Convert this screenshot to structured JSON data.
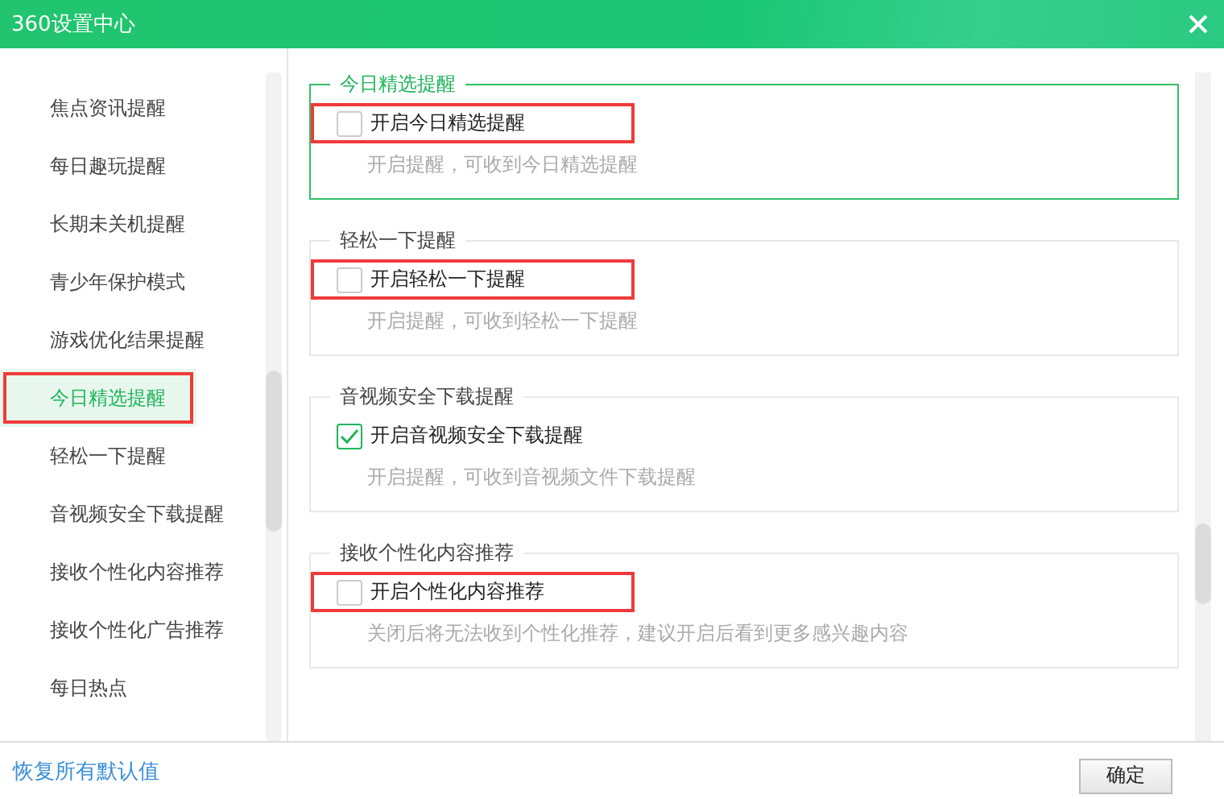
{
  "window": {
    "title": "360设置中心"
  },
  "sidebar": {
    "items": [
      {
        "label": "焦点资讯提醒",
        "selected": false,
        "annotated": false
      },
      {
        "label": "每日趣玩提醒",
        "selected": false,
        "annotated": false
      },
      {
        "label": "长期未关机提醒",
        "selected": false,
        "annotated": false
      },
      {
        "label": "青少年保护模式",
        "selected": false,
        "annotated": false
      },
      {
        "label": "游戏优化结果提醒",
        "selected": false,
        "annotated": false
      },
      {
        "label": "今日精选提醒",
        "selected": true,
        "annotated": true
      },
      {
        "label": "轻松一下提醒",
        "selected": false,
        "annotated": false
      },
      {
        "label": "音视频安全下载提醒",
        "selected": false,
        "annotated": false
      },
      {
        "label": "接收个性化内容推荐",
        "selected": false,
        "annotated": false
      },
      {
        "label": "接收个性化广告推荐",
        "selected": false,
        "annotated": false
      },
      {
        "label": "每日热点",
        "selected": false,
        "annotated": false
      }
    ]
  },
  "sections": [
    {
      "title": "今日精选提醒",
      "selected": true,
      "option": {
        "label": "开启今日精选提醒",
        "checked": false,
        "annotated": true
      },
      "description": "开启提醒，可收到今日精选提醒"
    },
    {
      "title": "轻松一下提醒",
      "selected": false,
      "option": {
        "label": "开启轻松一下提醒",
        "checked": false,
        "annotated": true
      },
      "description": "开启提醒，可收到轻松一下提醒"
    },
    {
      "title": "音视频安全下载提醒",
      "selected": false,
      "option": {
        "label": "开启音视频安全下载提醒",
        "checked": true,
        "annotated": false
      },
      "description": "开启提醒，可收到音视频文件下载提醒"
    },
    {
      "title": "接收个性化内容推荐",
      "selected": false,
      "option": {
        "label": "开启个性化内容推荐",
        "checked": false,
        "annotated": true
      },
      "description": "关闭后将无法收到个性化推荐，建议开启后看到更多感兴趣内容"
    }
  ],
  "footer": {
    "reset_link": "恢复所有默认值",
    "ok_button": "确定"
  }
}
